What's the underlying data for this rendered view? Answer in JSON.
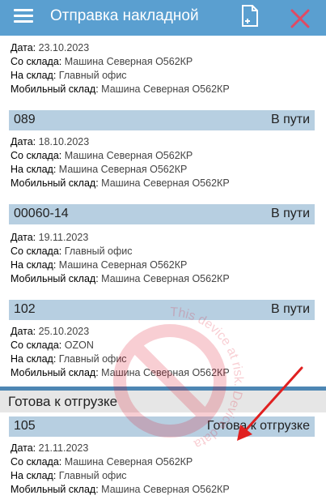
{
  "header": {
    "title": "Отправка накладной",
    "menu_icon": "hamburger-menu-icon",
    "doc_icon": "new-document-icon",
    "close_icon": "close-icon",
    "colors": {
      "bar": "#5a9fd0",
      "close": "#e04a63"
    }
  },
  "labels": {
    "date": "Дата: ",
    "from": "Со склада: ",
    "to": "На склад: ",
    "mobile": "Мобильный склад: "
  },
  "items": [
    {
      "date": "23.10.2023",
      "from": "Машина Северная О562КР",
      "to": "Главный офис",
      "mobile": "Машина Северная О562КР"
    },
    {
      "number": "089",
      "status": "В пути",
      "date": "18.10.2023",
      "from": "Машина Северная О562КР",
      "to": "Машина Северная О562КР",
      "mobile": "Машина Северная О562КР"
    },
    {
      "number": "00060-14",
      "status": "В пути",
      "date": "19.11.2023",
      "from": "Главный офис",
      "to": "Машина Северная О562КР",
      "mobile": "Машина Северная О562КР"
    },
    {
      "number": "102",
      "status": "В пути",
      "date": "25.10.2023",
      "from": "OZON",
      "to": "Главный офис",
      "mobile": "Машина Северная О562КР"
    }
  ],
  "section": {
    "title": "Готова к отгрузке"
  },
  "ready_items": [
    {
      "number": "105",
      "status": "Готова к отгрузке",
      "date": "21.11.2023",
      "from": "Машина Северная О562КР",
      "to": "Главный офис",
      "mobile": "Машина Северная О562КР"
    }
  ],
  "watermark": {
    "text": "This device at risk. Device data"
  }
}
